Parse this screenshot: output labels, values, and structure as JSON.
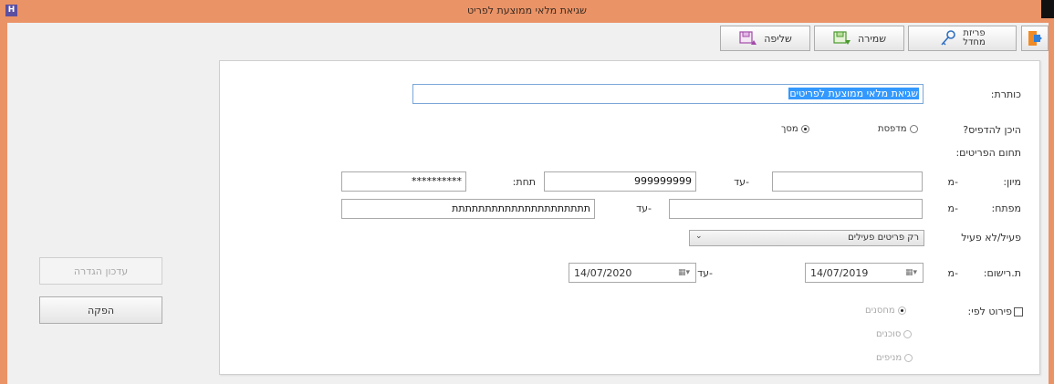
{
  "window": {
    "title": "שגיאת מלאי ממוצעת לפריט",
    "app_icon": "H"
  },
  "toolbar": {
    "exit_icon": "exit-door-icon",
    "quick_exit_label_1": "פריזת",
    "quick_exit_label_2": "מחדל",
    "save_label": "שמירה",
    "recall_label": "שליפה"
  },
  "form": {
    "title_label": "כותרת:",
    "title_value": "שגיאת מלאי ממוצעת לפריטים",
    "print_to_label": "היכן להדפיס?",
    "print_options": [
      {
        "label": "מדפסת",
        "selected": false
      },
      {
        "label": "מסך",
        "selected": true
      }
    ],
    "range_section_label": "תחום הפריטים:",
    "sort_label": "מיון:",
    "from_label": "-מ",
    "to_label": "-עד",
    "sort_from_value": "",
    "sort_to_value": "999999999",
    "sort_mask_label": "תחת:",
    "sort_mask_value": "**********",
    "key_label": "מפתח:",
    "key_from_value": "",
    "key_to_value": "תתתתתתתתתתתתתתתתתתתתת",
    "active_label": "פעיל/לא פעיל",
    "active_value": "רק פריטים פעילים",
    "reg_date_label": "ת.רישום:",
    "reg_date_from": "14/07/2019",
    "reg_date_to": "14/07/2020",
    "breakdown_label": "פירוט לפי:",
    "breakdown_checked": false,
    "breakdown_options": [
      {
        "label": "מחסנים",
        "selected": true
      },
      {
        "label": "סוכנים",
        "selected": false
      },
      {
        "label": "מניפים",
        "selected": false
      }
    ]
  },
  "side": {
    "update_def_label": "עדכון הגדרה",
    "produce_label": "הפקה"
  },
  "colors": {
    "titlebar": "#ea9367",
    "selection": "#3399ff"
  }
}
